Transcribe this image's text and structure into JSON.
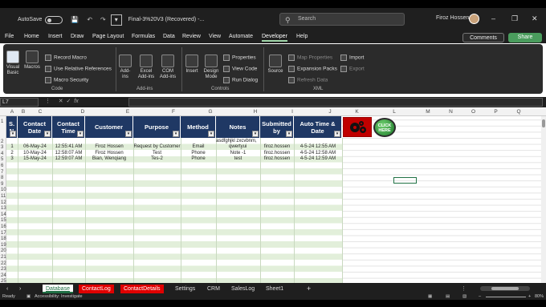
{
  "titlebar": {
    "autosave": "AutoSave",
    "autosave_state": "Off",
    "doc_title": "Final-3%20V3 (Recovered) -...",
    "search_placeholder": "Search",
    "user": "Firoz Hossen"
  },
  "menu": [
    "File",
    "Home",
    "Insert",
    "Draw",
    "Page Layout",
    "Formulas",
    "Data",
    "Review",
    "View",
    "Automate",
    "Developer",
    "Help"
  ],
  "menu_active": "Developer",
  "comments": "Comments",
  "share": "Share",
  "ribbon": {
    "code": {
      "visual_basic": "Visual Basic",
      "macros": "Macros",
      "record_macro": "Record Macro",
      "use_relative": "Use Relative References",
      "macro_security": "Macro Security",
      "label": "Code"
    },
    "addins": {
      "addins": "Add-ins",
      "excel_addins": "Excel Add-ins",
      "com_addins": "COM Add-ins",
      "label": "Add-ins"
    },
    "controls": {
      "insert": "Insert",
      "design_mode": "Design Mode",
      "properties": "Properties",
      "view_code": "View Code",
      "run_dialog": "Run Dialog",
      "label": "Controls"
    },
    "xml": {
      "source": "Source",
      "map_properties": "Map Properties",
      "expansion_packs": "Expansion Packs",
      "refresh_data": "Refresh Data",
      "import": "Import",
      "export": "Export",
      "label": "XML"
    }
  },
  "formulabar": {
    "namebox": "L7",
    "fx": "fx"
  },
  "columns": [
    "A",
    "B",
    "C",
    "D",
    "E",
    "F",
    "G",
    "H",
    "I",
    "J",
    "K",
    "L",
    "M",
    "N",
    "O",
    "P",
    "Q"
  ],
  "rows": [
    "1",
    "2",
    "3",
    "4",
    "5",
    "6",
    "7",
    "8",
    "9",
    "10",
    "11",
    "12",
    "13",
    "14",
    "15",
    "16",
    "17",
    "18",
    "19",
    "20",
    "21",
    "22",
    "23",
    "24",
    "25"
  ],
  "headers": [
    "S. N",
    "Contact Date",
    "Contact Time",
    "Customer",
    "Purpose",
    "Method",
    "Notes",
    "Submitted by",
    "Auto Time & Date"
  ],
  "notes_overflow": [
    "asdfghjkl zxcvbnm,",
    "qwertyui"
  ],
  "records": [
    [
      "1",
      "06-May-24",
      "12:55:41 AM",
      "Firoz Hossen",
      "Request by Customer",
      "Email",
      "",
      "firoz.hossen",
      "4-5-24 12:55 AM"
    ],
    [
      "2",
      "10-May-24",
      "12:58:07 AM",
      "Firoz Hossen",
      "Test",
      "Phone",
      "Note -1",
      "firoz.hossen",
      "4-5-24 12:58 AM"
    ],
    [
      "3",
      "15-May-24",
      "12:59:07 AM",
      "Bian, Wenqiang",
      "Tes-2",
      "Phone",
      "test",
      "firoz.hossen",
      "4-5-24 12:59 AM"
    ]
  ],
  "click_here": "CLICK HERE",
  "tabs": [
    "Database",
    "ContactLog",
    "ContactDetails",
    "Settings",
    "CRM",
    "SalesLog",
    "Sheet1"
  ],
  "active_tab": "Database",
  "status": {
    "ready": "Ready",
    "accessibility": "Accessibility: Investigate",
    "zoom": "80%"
  },
  "colors": {
    "header_bg": "#1f3864",
    "band": "#e2efda",
    "tab_red": "#e00000",
    "accent": "#217346"
  }
}
